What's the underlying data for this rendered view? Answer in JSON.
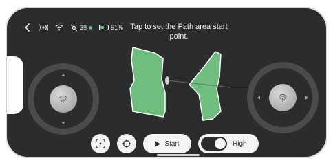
{
  "status_bar": {
    "back_icon": "chevron-left-icon",
    "rc_icon": "remote-signal-icon",
    "wifi_icon": "wifi-icon",
    "satellite_icon": "satellite-icon",
    "satellite_count": "39",
    "battery_icon": "battery-icon",
    "battery_percent": "51%",
    "battery_level": 0.51
  },
  "hint": "Tap to set the Path area start point.",
  "joysticks": {
    "left": {
      "name": "left-joystick",
      "icon": "fingerprint-icon"
    },
    "right": {
      "name": "right-joystick",
      "icon": "fingerprint-icon"
    }
  },
  "controls": {
    "focus_icon": "focus-frame-icon",
    "locate_icon": "crosshair-icon",
    "start_icon": "play-icon",
    "start_label": "Start",
    "toggle_state": "on",
    "toggle_label": "High"
  },
  "colors": {
    "background": "#2b2c2e",
    "area_fill": "#6fbe7e",
    "button_bg": "#f4f4f4",
    "status_green": "#58c47a"
  }
}
